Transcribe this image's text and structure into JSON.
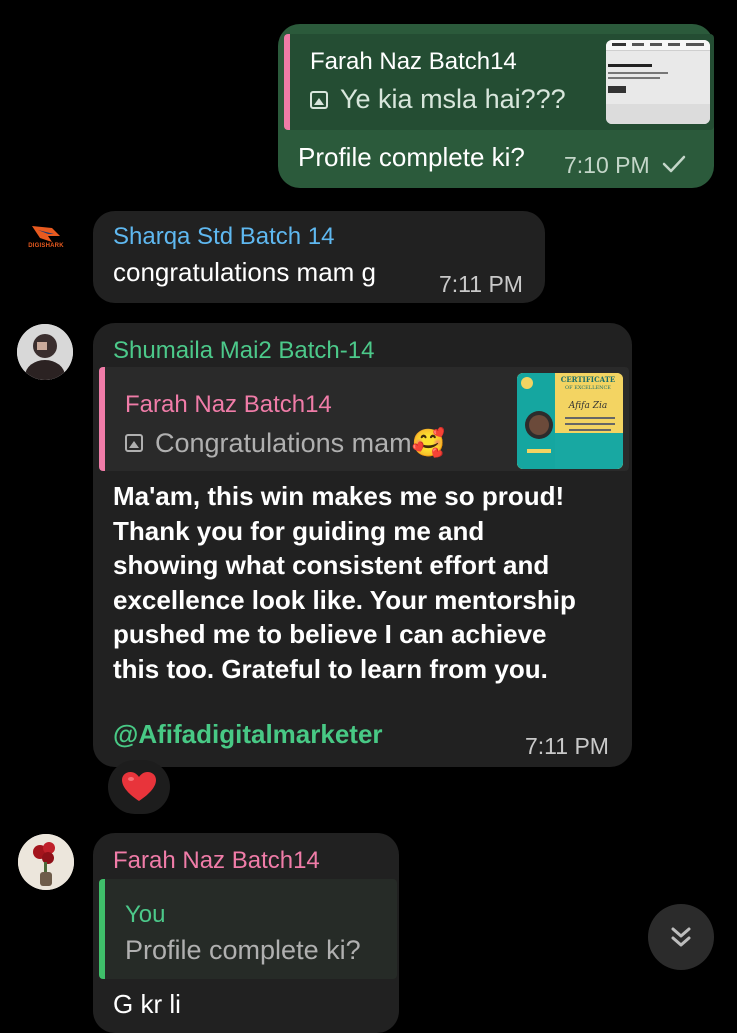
{
  "colors": {
    "background": "#000000",
    "bubble_out": "#2b5a3b",
    "bubble_in": "#212121",
    "name_pink": "#f07ca8",
    "name_blue": "#5fb8f0",
    "name_green": "#4cc98a",
    "mention_green": "#48c985",
    "quote_green_bar": "#3fbf6a",
    "heart_red": "#e8343b"
  },
  "messages": [
    {
      "direction": "out",
      "reply": {
        "name": "Farah Naz Batch14",
        "text": "Ye kia msla hai???",
        "has_image": true
      },
      "text": "Profile complete ki?",
      "time": "7:10 PM",
      "status_icon": "check-icon"
    },
    {
      "direction": "in",
      "sender": "Sharqa Std Batch 14",
      "avatar_label": "DIGISHARK",
      "text": "congratulations mam g",
      "time": "7:11 PM"
    },
    {
      "direction": "in",
      "sender": "Shumaila Mai2 Batch-14",
      "reply": {
        "name": "Farah Naz Batch14",
        "text": "Congratulations mam🥰",
        "has_image": true
      },
      "lines": [
        "Ma'am, this win makes me so proud!",
        "Thank you for guiding me and",
        "showing what consistent effort and",
        "excellence look like. Your mentorship",
        "pushed me to believe I can achieve",
        "this too. Grateful to learn from you."
      ],
      "mention": "@Afifadigitalmarketer",
      "time": "7:11 PM",
      "reaction": "❤️",
      "thumbnail": {
        "header": "CERTIFICATE",
        "subheader": "OF EXCELLENCE",
        "name": "Afifa Zia"
      }
    },
    {
      "direction": "in",
      "sender": "Farah Naz Batch14",
      "reply": {
        "name": "You",
        "text": "Profile complete ki?"
      },
      "text_partial": "G kr li"
    }
  ],
  "scroll_button": {
    "icon": "double-chevron-down-icon"
  }
}
